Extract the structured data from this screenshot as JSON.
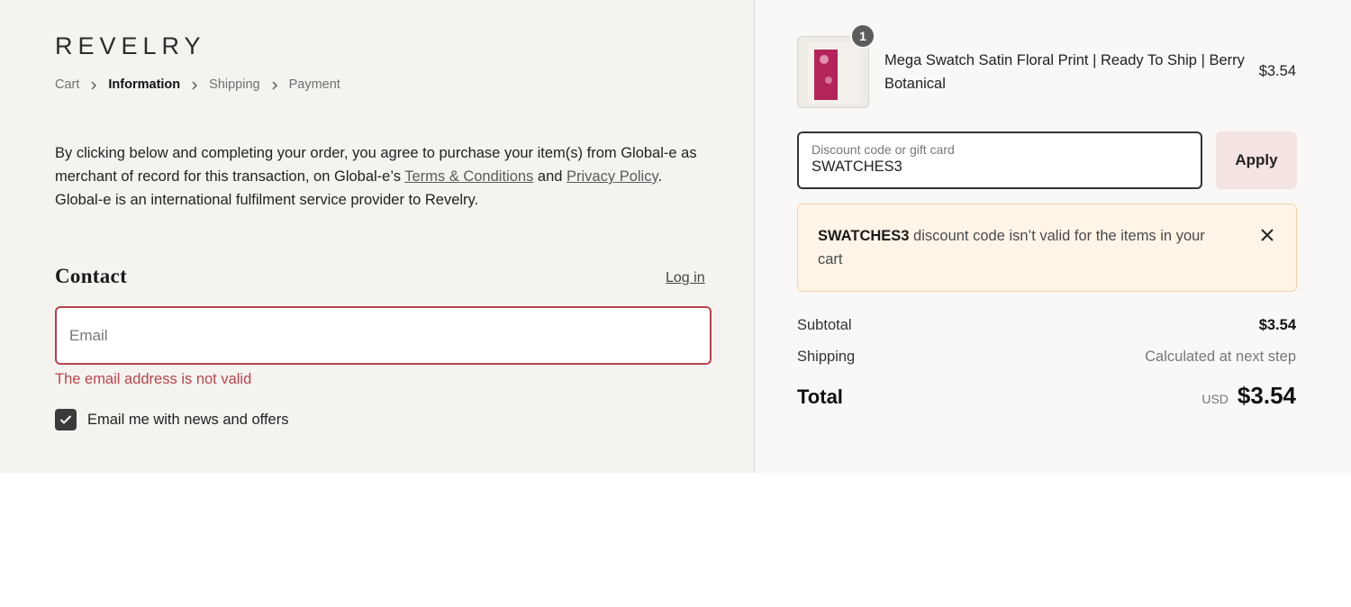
{
  "brand": {
    "logo_text": "REVELRY"
  },
  "breadcrumb": {
    "items": [
      {
        "label": "Cart"
      },
      {
        "label": "Information"
      },
      {
        "label": "Shipping"
      },
      {
        "label": "Payment"
      }
    ]
  },
  "notice": {
    "text_before": "By clicking below and completing your order, you agree to purchase your item(s) from Global-e as merchant of record for this transaction, on Global-e’s ",
    "terms_link": "Terms & Conditions",
    "text_middle": " and ",
    "privacy_link": "Privacy Policy",
    "text_after": ". Global-e is an international fulfilment service provider to Revelry."
  },
  "contact": {
    "title": "Contact",
    "login_link": "Log in",
    "email_placeholder": "Email",
    "email_value": "",
    "email_error": "The email address is not valid",
    "newsletter_label": "Email me with news and offers",
    "newsletter_checked": true
  },
  "order": {
    "product": {
      "name": "Mega Swatch Satin Floral Print | Ready To Ship | Berry Botanical",
      "price": "$3.54",
      "quantity": "1"
    },
    "discount": {
      "label": "Discount code or gift card",
      "value": "SWATCHES3",
      "apply_label": "Apply"
    },
    "alert": {
      "code": "SWATCHES3",
      "message": " discount code isn’t valid for the items in your cart"
    },
    "summary": {
      "subtotal_label": "Subtotal",
      "subtotal_value": "$3.54",
      "shipping_label": "Shipping",
      "shipping_value": "Calculated at next step",
      "total_label": "Total",
      "currency": "USD",
      "total_value": "$3.54"
    }
  },
  "colors": {
    "left_background": "#f5f3ef",
    "right_background": "#f9f8f6",
    "error": "#b5454e",
    "apply_button": "#f3e3e1",
    "alert_background": "#fff4e8"
  },
  "icons": {
    "breadcrumb_separator": "chevron-right-icon",
    "checkbox": "checkmark-icon",
    "alert_close": "close-icon"
  }
}
